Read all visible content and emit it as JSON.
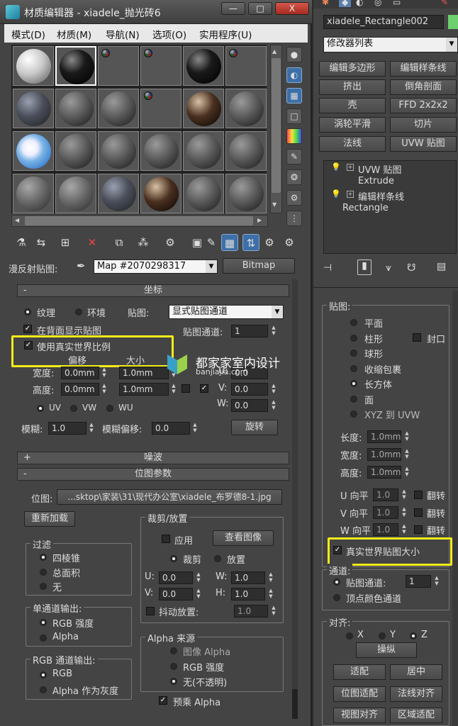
{
  "window": {
    "title": "材质编辑器 - xiadele_抛光砖6",
    "min": "—",
    "max": "□",
    "close": "X"
  },
  "menu": [
    "模式(D)",
    "材质(M)",
    "导航(N)",
    "选项(O)",
    "实用程序(U)"
  ],
  "slots": [
    [
      "white",
      "black",
      "chk",
      "chk",
      "black",
      "chk"
    ],
    [
      "mix",
      "grey",
      "grey",
      "chk",
      "wood",
      "grey"
    ],
    [
      "sky",
      "grey",
      "grey",
      "grey",
      "grey",
      "grey"
    ],
    [
      "stone",
      "stone",
      "mix",
      "wood",
      "grey",
      "grey"
    ]
  ],
  "diffuse": {
    "label": "漫反射贴图:",
    "map": "Map #2070298317",
    "type": "Bitmap"
  },
  "coords": {
    "title": "坐标",
    "texture": "纹理",
    "env": "环境",
    "mapping_label": "贴图:",
    "mapping_value": "显式贴图通道",
    "show_back": "在背面显示贴图",
    "channel_label": "贴图通道:",
    "channel_value": "1",
    "real_world": "使用真实世界比例",
    "offset": "偏移",
    "size": "大小",
    "width_label": "宽度:",
    "width_offset": "0.0mm",
    "width_size": "1.0mm",
    "height_label": "高度:",
    "height_offset": "0.0mm",
    "height_size": "1.0mm",
    "u_label": "U:",
    "u_value": "0.0",
    "v_label": "V:",
    "v_value": "0.0",
    "w_label": "W:",
    "w_value": "0.0",
    "uv": "UV",
    "vw": "VW",
    "wu": "WU",
    "blur_label": "模糊:",
    "blur_value": "1.0",
    "blur_off_label": "模糊偏移:",
    "blur_off_value": "0.0",
    "rotate": "旋转"
  },
  "noise": {
    "title": "噪波"
  },
  "bitmap": {
    "title": "位图参数",
    "path_label": "位图:",
    "path": "...sktop\\家装\\31\\现代办公室\\xiadele_布罗德8-1.jpg",
    "reload": "重新加载",
    "filter_title": "过滤",
    "f1": "四棱锥",
    "f2": "总面积",
    "f3": "无",
    "mono_title": "单通道输出:",
    "m1": "RGB 强度",
    "m2": "Alpha",
    "rgb_title": "RGB 通道输出:",
    "r1": "RGB",
    "r2": "Alpha 作为灰度",
    "crop_title": "裁剪/放置",
    "apply": "应用",
    "view": "查看图像",
    "crop": "裁剪",
    "place": "放置",
    "u": "U:",
    "u_val": "0.0",
    "w": "W:",
    "w_val": "1.0",
    "v": "V:",
    "v_val": "0.0",
    "h": "H:",
    "h_val": "1.0",
    "jitter": "抖动放置:",
    "jitter_val": "1.0",
    "alpha_title": "Alpha 来源",
    "a1": "图像 Alpha",
    "a2": "RGB 强度",
    "a3": "无(不透明)",
    "premult": "预乘 Alpha"
  },
  "watermark": {
    "brand": "都家家室内设计",
    "url": "banjiajia.com"
  },
  "cmd": {
    "object_name": "xiadele_Rectangle002",
    "modifier_list": "修改器列表",
    "buttons": [
      "编辑多边形",
      "编辑样条线",
      "挤出",
      "倒角剖面",
      "壳",
      "FFD 2x2x2",
      "涡轮平滑",
      "切片",
      "法线",
      "UVW 贴图"
    ],
    "stack": [
      "UVW 贴图",
      "Extrude",
      "编辑样条线",
      "Rectangle"
    ],
    "map_title": "贴图:",
    "mapping": [
      "平面",
      "柱形",
      "球形",
      "收缩包裹",
      "长方体",
      "面",
      "XYZ 到 UVW"
    ],
    "cap": "封口",
    "length_label": "长度:",
    "length": "1.0mm",
    "width_label": "宽度:",
    "width": "1.0mm",
    "height_label": "高度:",
    "height": "1.0mm",
    "utile": "U 向平",
    "vtile": "V 向平",
    "wtile": "W 向平",
    "tile_val": "1.0",
    "flip": "翻转",
    "real_world": "真实世界贴图大小",
    "channel_title": "通道:",
    "map_channel": "贴图通道:",
    "map_channel_val": "1",
    "vertex_color": "顶点颜色通道",
    "align_title": "对齐:",
    "ax": "X",
    "ay": "Y",
    "az": "Z",
    "manip": "操纵",
    "fit": "适配",
    "center": "居中",
    "bitmap_fit": "位图适配",
    "normal_align": "法线对齐",
    "view_align": "视图对齐",
    "region_fit": "区域适配"
  }
}
